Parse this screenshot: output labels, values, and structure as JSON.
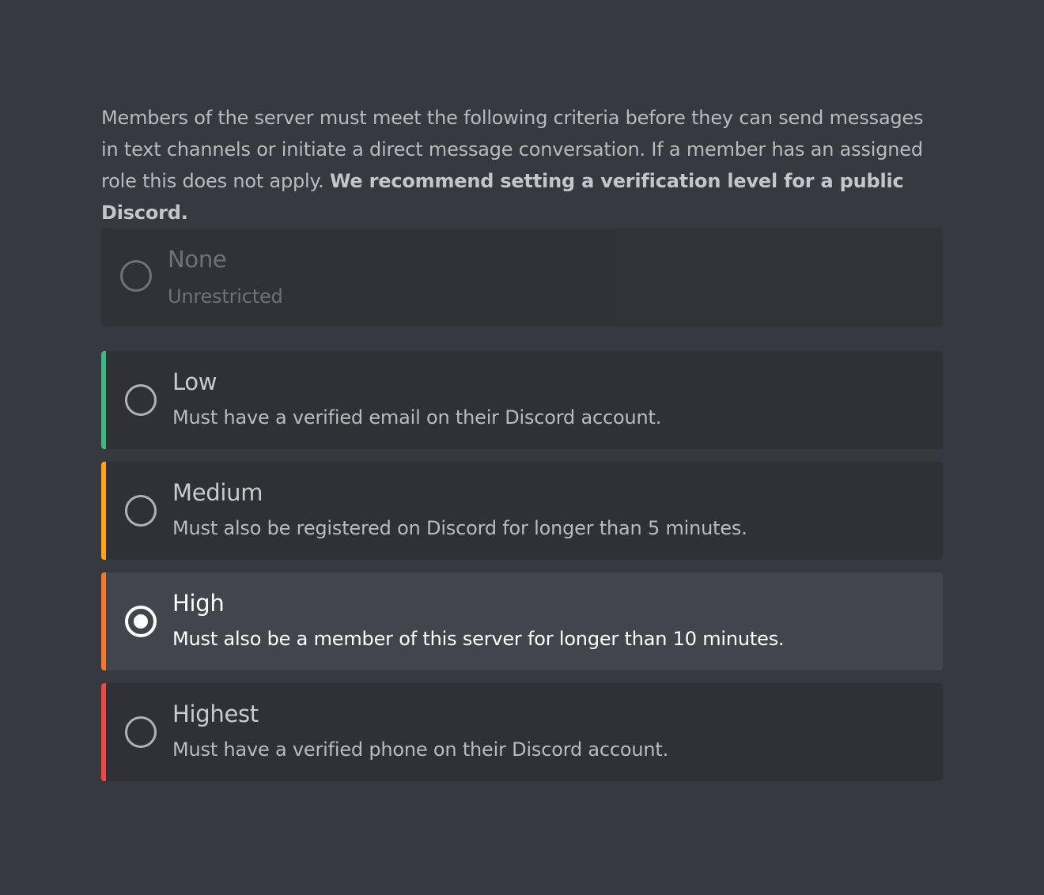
{
  "description": {
    "text": "Members of the server must meet the following criteria before they can send messages in text channels or initiate a direct message conversation. If a member has an assigned role this does not apply. ",
    "bold": "We recommend setting a verification level for a public Discord."
  },
  "levels": [
    {
      "title": "None",
      "description": "Unrestricted",
      "color": "",
      "state": "disabled"
    },
    {
      "title": "Low",
      "description": "Must have a verified email on their Discord account.",
      "color": "#43b581",
      "state": "unselected"
    },
    {
      "title": "Medium",
      "description": "Must also be registered on Discord for longer than 5 minutes.",
      "color": "#faa61a",
      "state": "unselected"
    },
    {
      "title": "High",
      "description": "Must also be a member of this server for longer than 10 minutes.",
      "color": "#f57731",
      "state": "selected"
    },
    {
      "title": "Highest",
      "description": "Must have a verified phone on their Discord account.",
      "color": "#f04747",
      "state": "unselected"
    }
  ]
}
